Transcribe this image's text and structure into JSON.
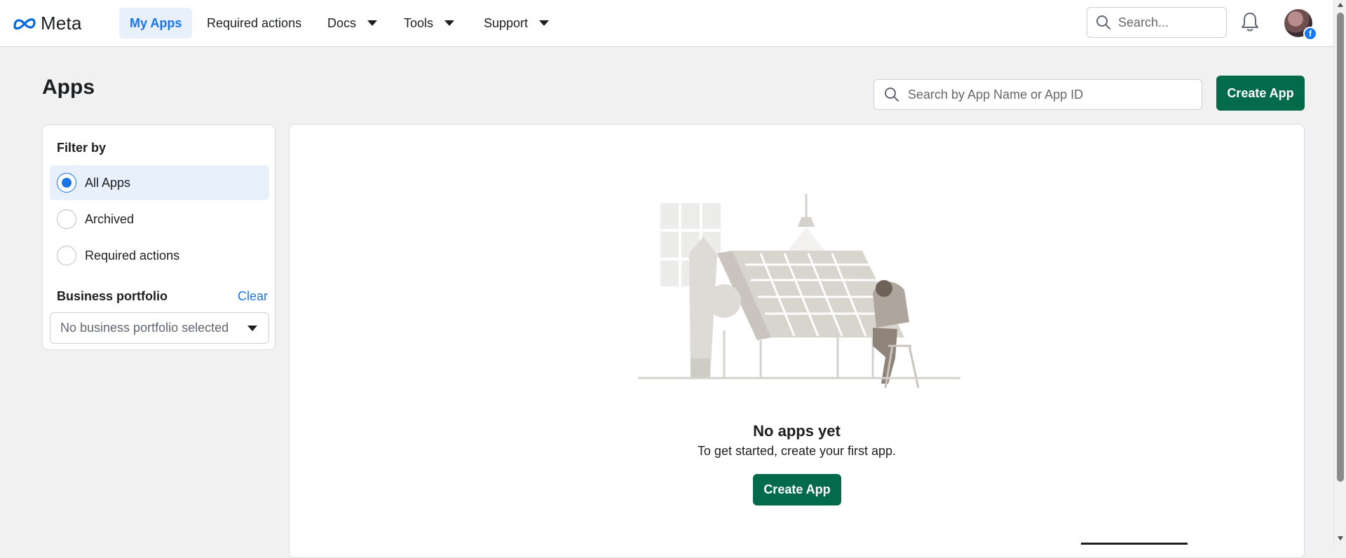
{
  "brand": {
    "name": "Meta"
  },
  "nav": {
    "items": [
      {
        "label": "My Apps",
        "active": true
      },
      {
        "label": "Required actions"
      },
      {
        "label": "Docs",
        "has_dropdown": true
      },
      {
        "label": "Tools",
        "has_dropdown": true
      },
      {
        "label": "Support",
        "has_dropdown": true
      }
    ],
    "search_placeholder": "Search...",
    "icons": [
      "search-icon",
      "bell-icon",
      "avatar"
    ]
  },
  "page": {
    "title": "Apps",
    "search_placeholder": "Search by App Name or App ID",
    "create_button": "Create App"
  },
  "filter": {
    "title": "Filter by",
    "options": [
      {
        "label": "All Apps",
        "selected": true
      },
      {
        "label": "Archived",
        "selected": false
      },
      {
        "label": "Required actions",
        "selected": false
      }
    ],
    "business_portfolio_label": "Business portfolio",
    "clear_label": "Clear",
    "business_portfolio_value": "No business portfolio selected"
  },
  "empty_state": {
    "title": "No apps yet",
    "subtitle": "To get started, create your first app.",
    "button": "Create App"
  },
  "colors": {
    "primary_button": "#036b4a",
    "link_blue": "#1b74e4",
    "active_nav_bg": "#e7f0fb",
    "page_bg": "#f1f1f1"
  }
}
